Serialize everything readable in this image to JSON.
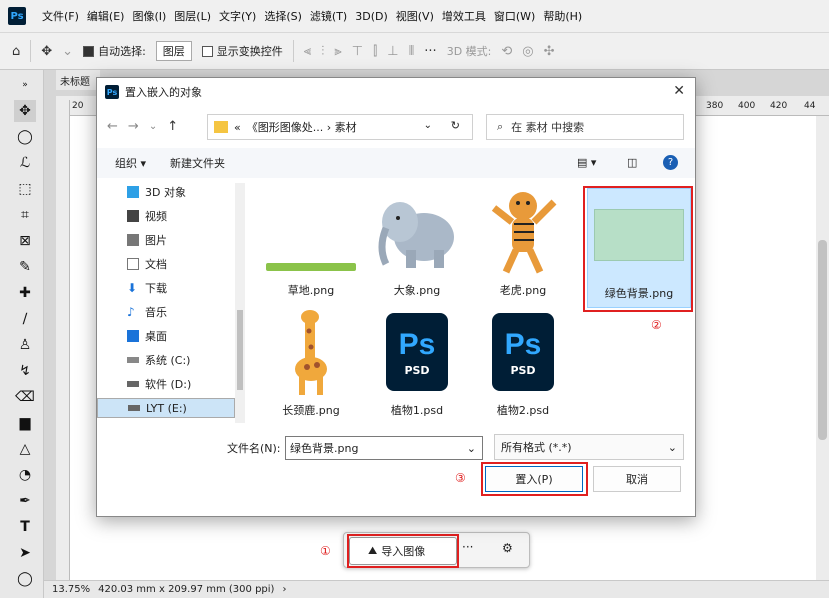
{
  "app": {
    "logo": "Ps",
    "menus": [
      "文件(F)",
      "编辑(E)",
      "图像(I)",
      "图层(L)",
      "文字(Y)",
      "选择(S)",
      "滤镜(T)",
      "3D(D)",
      "视图(V)",
      "增效工具",
      "窗口(W)",
      "帮助(H)"
    ]
  },
  "options": {
    "auto_select_label": "自动选择:",
    "layer_select": "图层",
    "show_transform_label": "显示变换控件",
    "mode_3d_label": "3D 模式:"
  },
  "doc": {
    "tab_label": "未标题",
    "ruler_left": "20",
    "ruler_right": [
      "380",
      "400",
      "420",
      "44"
    ],
    "status_zoom": "13.75%",
    "status_info": "420.03 mm x 209.97 mm (300 ppi)"
  },
  "taskbar": {
    "import_label": "导入图像",
    "more_label": "···"
  },
  "dialog": {
    "title": "置入嵌入的对象",
    "path": "《图形图像处... › 素材",
    "path_prefix": "«",
    "search_placeholder": "在 素材 中搜索",
    "organize": "组织 ▾",
    "new_folder": "新建文件夹",
    "nav_items": [
      {
        "label": "3D 对象",
        "icon": "cube-icon",
        "color": "#2ea0e6"
      },
      {
        "label": "视频",
        "icon": "video-icon",
        "color": "#444"
      },
      {
        "label": "图片",
        "icon": "picture-icon",
        "color": "#555"
      },
      {
        "label": "文档",
        "icon": "document-icon",
        "color": "#555"
      },
      {
        "label": "下载",
        "icon": "download-icon",
        "color": "#1a73d9"
      },
      {
        "label": "音乐",
        "icon": "music-icon",
        "color": "#1a73d9"
      },
      {
        "label": "桌面",
        "icon": "desktop-icon",
        "color": "#1a73d9"
      },
      {
        "label": "系统 (C:)",
        "icon": "drive-icon",
        "color": "#444"
      },
      {
        "label": "软件 (D:)",
        "icon": "drive-icon",
        "color": "#444"
      },
      {
        "label": "LYT (E:)",
        "icon": "drive-icon",
        "color": "#444"
      }
    ],
    "files": [
      {
        "name": "草地.png",
        "icon": "grass-thumbnail"
      },
      {
        "name": "大象.png",
        "icon": "elephant-thumbnail"
      },
      {
        "name": "老虎.png",
        "icon": "tiger-thumbnail"
      },
      {
        "name": "绿色背景.png",
        "icon": "green-background-thumbnail",
        "selected": true
      },
      {
        "name": "长颈鹿.png",
        "icon": "giraffe-thumbnail"
      },
      {
        "name": "植物1.psd",
        "icon": "psd-file-icon"
      },
      {
        "name": "植物2.psd",
        "icon": "psd-file-icon"
      }
    ],
    "psd_big": "Ps",
    "psd_small": "PSD",
    "filename_label": "文件名(N):",
    "filename_value": "绿色背景.png",
    "filetype_value": "所有格式 (*.*)",
    "place_button": "置入(P)",
    "cancel_button": "取消"
  },
  "callouts": [
    "①",
    "②",
    "③"
  ],
  "colors": {
    "highlight_red": "#e02020",
    "selection_blue": "#cce8ff",
    "ps_dark": "#001e36",
    "ps_blue": "#31a8ff"
  }
}
